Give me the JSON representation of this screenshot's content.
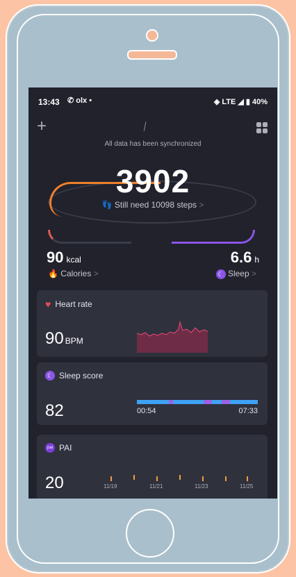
{
  "status": {
    "time": "13:43",
    "left_icons": "✆ olx •",
    "right": "◈ LTE ◢ ▮ 40%"
  },
  "header": {
    "sync_text": "All data has been synchronized"
  },
  "steps": {
    "value": "3902",
    "need_text": "Still need 10098 steps",
    "chevron": ">"
  },
  "calories": {
    "value": "90",
    "unit": "kcal",
    "label": "Calories",
    "chevron": ">"
  },
  "sleep": {
    "value": "6.6",
    "unit": "h",
    "label": "Sleep",
    "chevron": ">"
  },
  "heart": {
    "title": "Heart rate",
    "value": "90",
    "unit": "BPM"
  },
  "sleep_score": {
    "title": "Sleep score",
    "value": "82",
    "start": "00:54",
    "end": "07:33"
  },
  "pai": {
    "title": "PAI",
    "value": "20",
    "dates": [
      "11/19",
      "11/21",
      "11/23",
      "11/25"
    ],
    "icon_text": "pai"
  },
  "colors": {
    "accent_orange": "#f07f2c",
    "sleep_purple": "#8b55e6",
    "heart_red": "#e94b5b",
    "sleep_blue": "#3ea2f4"
  }
}
